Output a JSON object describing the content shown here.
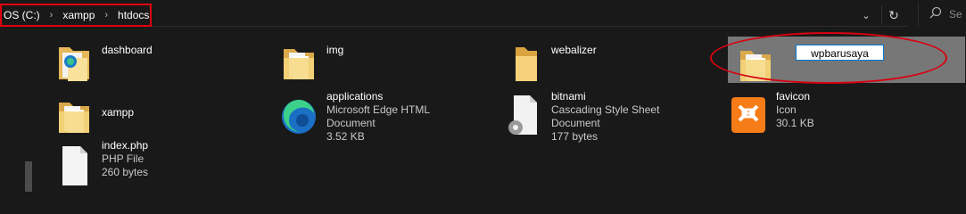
{
  "address": {
    "crumbs": [
      "OS (C:)",
      "xampp",
      "htdocs"
    ],
    "separator": "›",
    "search_placeholder": "Se"
  },
  "files": [
    {
      "name": "dashboard",
      "icon": "folder-dashboard-icon"
    },
    {
      "name": "img",
      "icon": "folder-icon"
    },
    {
      "name": "webalizer",
      "icon": "folder-icon"
    },
    {
      "name": "wpbarusaya",
      "icon": "folder-icon",
      "selected": true,
      "renaming": true
    },
    {
      "name": "xampp",
      "icon": "folder-icon"
    },
    {
      "name": "applications",
      "type": "Microsoft Edge HTML Document",
      "size": "3.52 KB",
      "icon": "edge-icon"
    },
    {
      "name": "bitnami",
      "type": "Cascading Style Sheet Document",
      "size": "177 bytes",
      "icon": "css-file-icon"
    },
    {
      "name": "favicon",
      "type": "Icon",
      "size": "30.1 KB",
      "icon": "xampp-icon"
    },
    {
      "name": "index.php",
      "type": "PHP File",
      "size": "260 bytes",
      "icon": "blank-file-icon"
    }
  ],
  "colors": {
    "background": "#191919",
    "annotation": "#d80010",
    "selected": "#777777"
  }
}
